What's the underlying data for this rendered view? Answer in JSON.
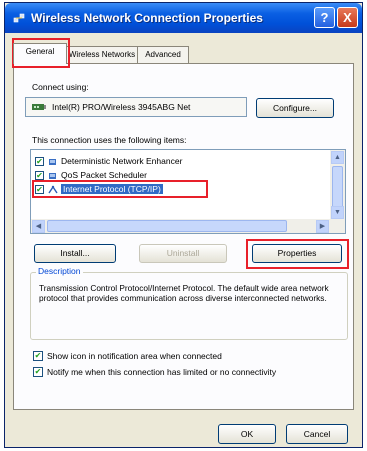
{
  "window": {
    "title": "Wireless Network Connection Properties",
    "help_label": "?",
    "close_label": "X"
  },
  "tabs": [
    {
      "label": "General",
      "active": true
    },
    {
      "label": "Wireless Networks",
      "active": false
    },
    {
      "label": "Advanced",
      "active": false
    }
  ],
  "connect_using": {
    "label": "Connect using:",
    "adapter_name": "Intel(R) PRO/Wireless 3945ABG Net",
    "adapter_icon": "network-adapter-icon",
    "configure_label": "Configure..."
  },
  "items_list": {
    "label": "This connection uses the following items:",
    "items": [
      {
        "label": "Deterministic Network Enhancer",
        "checked": true,
        "icon": "network-service-icon",
        "selected": false
      },
      {
        "label": "QoS Packet Scheduler",
        "checked": true,
        "icon": "network-service-icon",
        "selected": false
      },
      {
        "label": "Internet Protocol (TCP/IP)",
        "checked": true,
        "icon": "protocol-icon",
        "selected": true
      }
    ]
  },
  "buttons": {
    "install": "Install...",
    "uninstall": "Uninstall",
    "properties": "Properties",
    "ok": "OK",
    "cancel": "Cancel"
  },
  "description": {
    "legend": "Description",
    "text": "Transmission Control Protocol/Internet Protocol. The default wide area network protocol that provides communication across diverse interconnected networks."
  },
  "options": [
    {
      "label": "Show icon in notification area when connected",
      "checked": true
    },
    {
      "label": "Notify me when this connection has limited or no connectivity",
      "checked": true
    }
  ],
  "colors": {
    "titlebar": "#0a5fe3",
    "selection": "#316ac5",
    "highlight_box": "#e8202a",
    "dialog_bg": "#ece9d8"
  }
}
